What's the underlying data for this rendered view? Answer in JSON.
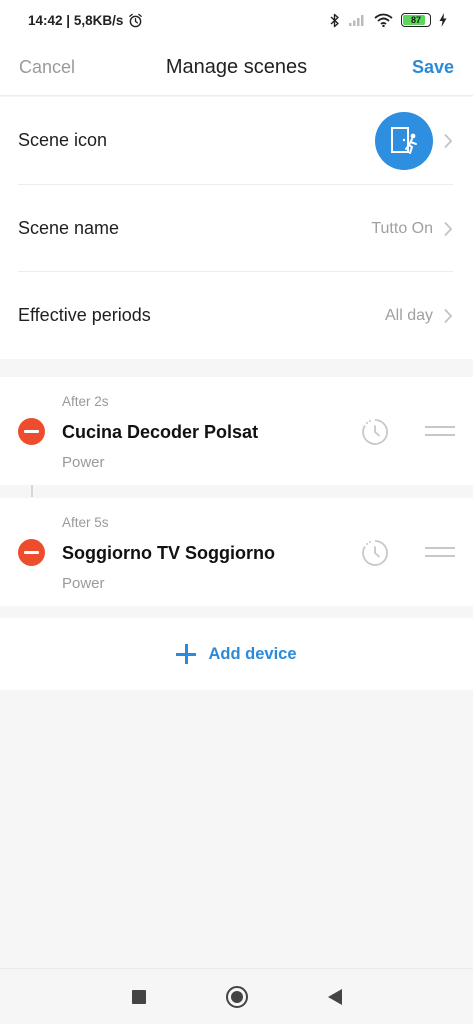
{
  "status_bar": {
    "time": "14:42",
    "network_speed": "5,8KB/s",
    "battery_level": "87",
    "icons": [
      "alarm-icon",
      "bluetooth-icon",
      "signal-icon",
      "wifi-icon",
      "battery-icon",
      "charging-icon"
    ]
  },
  "header": {
    "cancel_label": "Cancel",
    "title": "Manage scenes",
    "save_label": "Save"
  },
  "settings": {
    "scene_icon_label": "Scene icon",
    "scene_name_label": "Scene name",
    "scene_name_value": "Tutto On",
    "effective_periods_label": "Effective periods",
    "effective_periods_value": "All day"
  },
  "devices": [
    {
      "delay": "After 2s",
      "name": "Cucina Decoder Polsat",
      "action": "Power"
    },
    {
      "delay": "After 5s",
      "name": "Soggiorno TV Soggiorno",
      "action": "Power"
    }
  ],
  "add_device_label": "Add device",
  "colors": {
    "accent": "#2b8ad9",
    "remove": "#ee4d2d",
    "scene_icon_bg": "#2e8ee0",
    "battery_fill": "#5cd65c"
  }
}
